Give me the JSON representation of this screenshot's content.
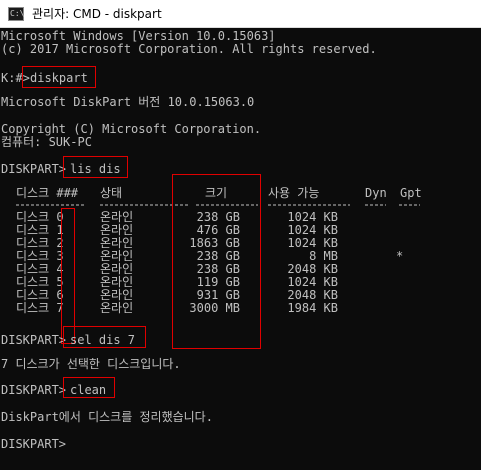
{
  "window": {
    "title": "관리자: CMD - diskpart",
    "icon": "cmd-icon"
  },
  "console": {
    "header_line1": "Microsoft Windows [Version 10.0.15063]",
    "header_line2": "(c) 2017 Microsoft Corporation. All rights reserved.",
    "prompt1": "K:#>",
    "cmd1": "diskpart",
    "diskpart_version": "Microsoft DiskPart 버전 10.0.15063.0",
    "copyright": "Copyright (C) Microsoft Corporation.",
    "computer": "컴퓨터: SUK-PC",
    "prompt2": "DISKPART>",
    "cmd2": "lis dis",
    "table": {
      "headers": [
        "디스크 ###",
        "상태",
        "크기",
        "사용 가능",
        "Dyn",
        "Gpt"
      ],
      "underline": "--------  -------------  -------  -------  ---  ---",
      "rows": [
        {
          "disk": "디스크 0",
          "status": "온라인",
          "size": "238 GB",
          "free": "1024 KB",
          "dyn": "",
          "gpt": ""
        },
        {
          "disk": "디스크 1",
          "status": "온라인",
          "size": "476 GB",
          "free": "1024 KB",
          "dyn": "",
          "gpt": ""
        },
        {
          "disk": "디스크 2",
          "status": "온라인",
          "size": "1863 GB",
          "free": "1024 KB",
          "dyn": "",
          "gpt": ""
        },
        {
          "disk": "디스크 3",
          "status": "온라인",
          "size": "238 GB",
          "free": "8 MB",
          "dyn": "",
          "gpt": "*"
        },
        {
          "disk": "디스크 4",
          "status": "온라인",
          "size": "238 GB",
          "free": "2048 KB",
          "dyn": "",
          "gpt": ""
        },
        {
          "disk": "디스크 5",
          "status": "온라인",
          "size": "119 GB",
          "free": "1024 KB",
          "dyn": "",
          "gpt": ""
        },
        {
          "disk": "디스크 6",
          "status": "온라인",
          "size": "931 GB",
          "free": "2048 KB",
          "dyn": "",
          "gpt": ""
        },
        {
          "disk": "디스크 7",
          "status": "온라인",
          "size": "3000 MB",
          "free": "1984 KB",
          "dyn": "",
          "gpt": ""
        }
      ]
    },
    "prompt3": "DISKPART>",
    "cmd3": "sel dis 7",
    "select_msg": "7 디스크가 선택한 디스크입니다.",
    "prompt4": "DISKPART>",
    "cmd4": "clean",
    "clean_msg": "DiskPart에서 디스크를 정리했습니다.",
    "prompt5": "DISKPART>"
  },
  "colors": {
    "background": "#0c0c0c",
    "text": "#c0c0c0",
    "highlight": "#e00000"
  }
}
